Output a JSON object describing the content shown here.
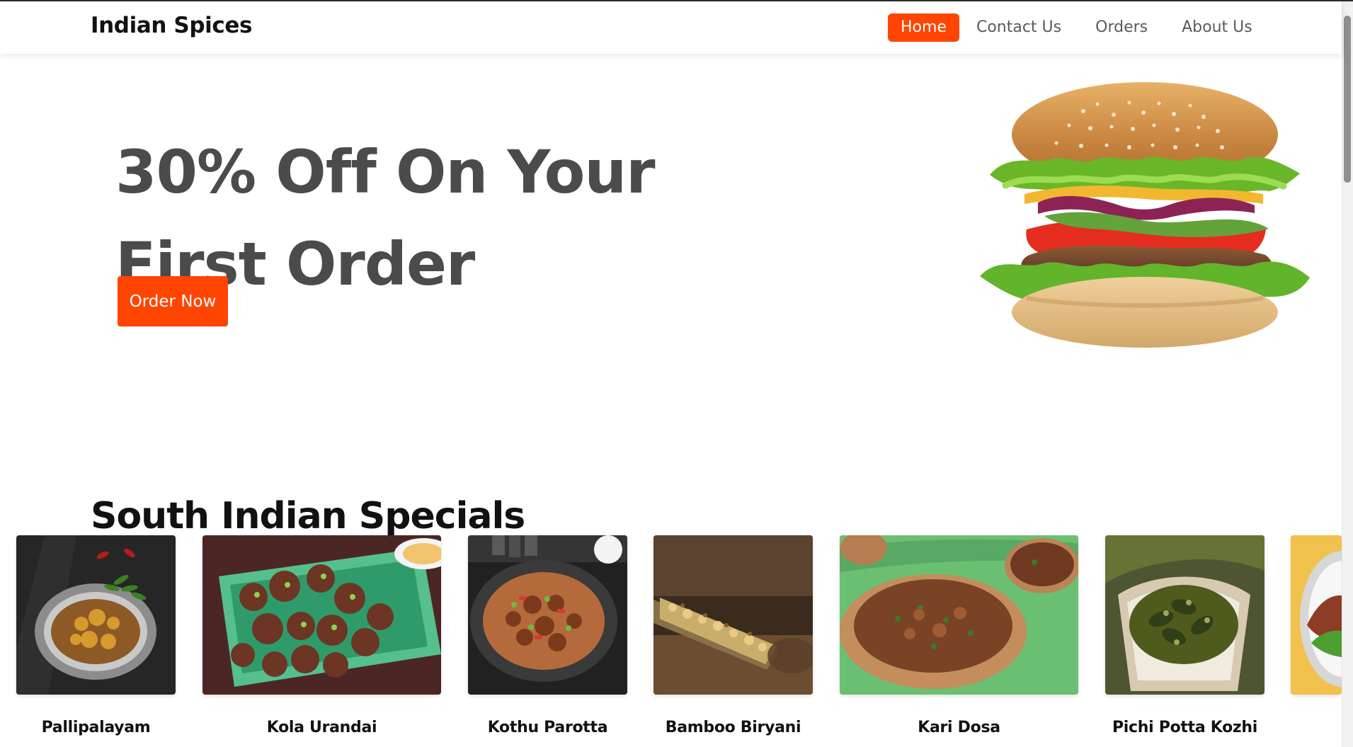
{
  "navbar": {
    "brand": "Indian Spices",
    "links": [
      {
        "label": "Home",
        "active": true
      },
      {
        "label": "Contact Us",
        "active": false
      },
      {
        "label": "Orders",
        "active": false
      },
      {
        "label": "About Us",
        "active": false
      }
    ]
  },
  "hero": {
    "title_line1": "30% Off On Your",
    "title_line2": "First Order",
    "cta_label": "Order Now",
    "image": "burger-image"
  },
  "specials": {
    "heading": "South Indian Specials",
    "items": [
      {
        "name": "Pallipalayam",
        "image": "pallipalayam-image"
      },
      {
        "name": "Kola Urandai",
        "image": "kola-urandai-image"
      },
      {
        "name": "Kothu Parotta",
        "image": "kothu-parotta-image"
      },
      {
        "name": "Bamboo Biryani",
        "image": "bamboo-biryani-image"
      },
      {
        "name": "Kari Dosa",
        "image": "kari-dosa-image"
      },
      {
        "name": "Pichi Potta Kozhi",
        "image": "pichi-potta-kozhi-image"
      },
      {
        "name": "",
        "image": "partial-dish-image"
      }
    ]
  },
  "colors": {
    "accent": "#ff4500",
    "hero_text": "#4b4b4b",
    "nav_text": "#5a5a5a",
    "heading_text": "#111111"
  }
}
